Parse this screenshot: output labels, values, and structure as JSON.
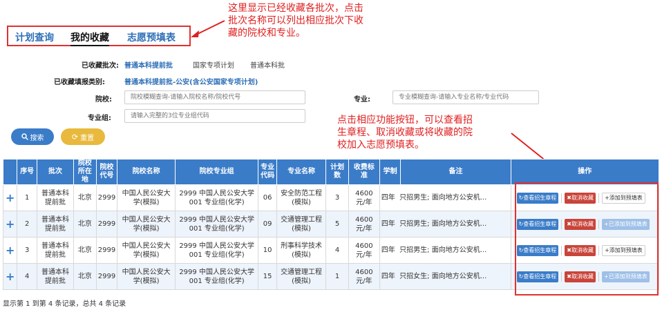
{
  "tabs": [
    {
      "label": "计划查询"
    },
    {
      "label": "我的收藏"
    },
    {
      "label": "志愿预填表"
    }
  ],
  "annotations": {
    "top": [
      "这里显示已经收藏各批次，点击",
      "批次名称可以列出相应批次下收",
      "藏的院校和专业。"
    ],
    "right": [
      "点击相应功能按钮，可以查看招",
      "生章程、取消收藏或将收藏的院",
      "校加入志愿预填表。"
    ]
  },
  "form": {
    "batch_label": "已收藏批次:",
    "batches": [
      "普通本科提前批",
      "国家专项计划",
      "普通本科批"
    ],
    "category_label": "已收藏填报类别:",
    "category_value": "普通本科提前批-公安(含公安国家专项计划)",
    "school_label": "院校:",
    "school_placeholder": "院校模糊查询-请输入院校名称/院校代号",
    "major_label": "专业:",
    "major_placeholder": "专业模糊查询-请输入专业名称/专业代码",
    "group_label": "专业组:",
    "group_placeholder": "请输入完整的3位专业组代码",
    "search_label": "搜索",
    "reset_label": "重置"
  },
  "table": {
    "headers": [
      "",
      "序号",
      "批次",
      "院校所在地",
      "院校代号",
      "院校名称",
      "院校专业组",
      "专业代码",
      "专业名称",
      "计划数",
      "收费标准",
      "学制",
      "备注",
      "操作"
    ],
    "rows": [
      {
        "plus": "+",
        "no": "1",
        "batch": "普通本科提前批",
        "loc": "北京",
        "code": "2999",
        "school": "中国人民公安大学(模拟)",
        "group": "2999 中国人民公安大学 001 专业组(化学)",
        "mcode": "06",
        "major": "安全防范工程(模拟)",
        "plan": "3",
        "fee": "4600 元/年",
        "years": "四年",
        "note": "只招男生; 面向地方公安机...",
        "view": "查看招生章程",
        "cancel": "取消收藏",
        "add": "+添加到预填表",
        "added": false
      },
      {
        "plus": "+",
        "no": "2",
        "batch": "普通本科提前批",
        "loc": "北京",
        "code": "2999",
        "school": "中国人民公安大学(模拟)",
        "group": "2999 中国人民公安大学 001 专业组(化学)",
        "mcode": "09",
        "major": "交通管理工程(模拟)",
        "plan": "5",
        "fee": "4600 元/年",
        "years": "四年",
        "note": "只招男生; 面向地方公安机...",
        "view": "查看招生章程",
        "cancel": "取消收藏",
        "add": "+已添加到预填表",
        "added": true
      },
      {
        "plus": "+",
        "no": "3",
        "batch": "普通本科提前批",
        "loc": "北京",
        "code": "2999",
        "school": "中国人民公安大学(模拟)",
        "group": "2999 中国人民公安大学 001 专业组(化学)",
        "mcode": "10",
        "major": "刑事科学技术(模拟)",
        "plan": "4",
        "fee": "4600 元/年",
        "years": "四年",
        "note": "只招男生; 面向地方公安机...",
        "view": "查看招生章程",
        "cancel": "取消收藏",
        "add": "+添加到预填表",
        "added": false
      },
      {
        "plus": "+",
        "no": "4",
        "batch": "普通本科提前批",
        "loc": "北京",
        "code": "2999",
        "school": "中国人民公安大学(模拟)",
        "group": "2999 中国人民公安大学 001 专业组(化学)",
        "mcode": "15",
        "major": "交通管理工程(模拟)",
        "plan": "1",
        "fee": "4600 元/年",
        "years": "四年",
        "note": "只招女生; 面向地方公安机...",
        "view": "查看招生章程",
        "cancel": "取消收藏",
        "add": "+已添加到预填表",
        "added": true
      }
    ]
  },
  "footer": "显示第 1 到第 4 条记录，总共 4 条记录",
  "colors": {
    "primary": "#3a7cc8",
    "danger": "#c9443a",
    "warning": "#e8b93c",
    "annotation": "#e02020"
  }
}
